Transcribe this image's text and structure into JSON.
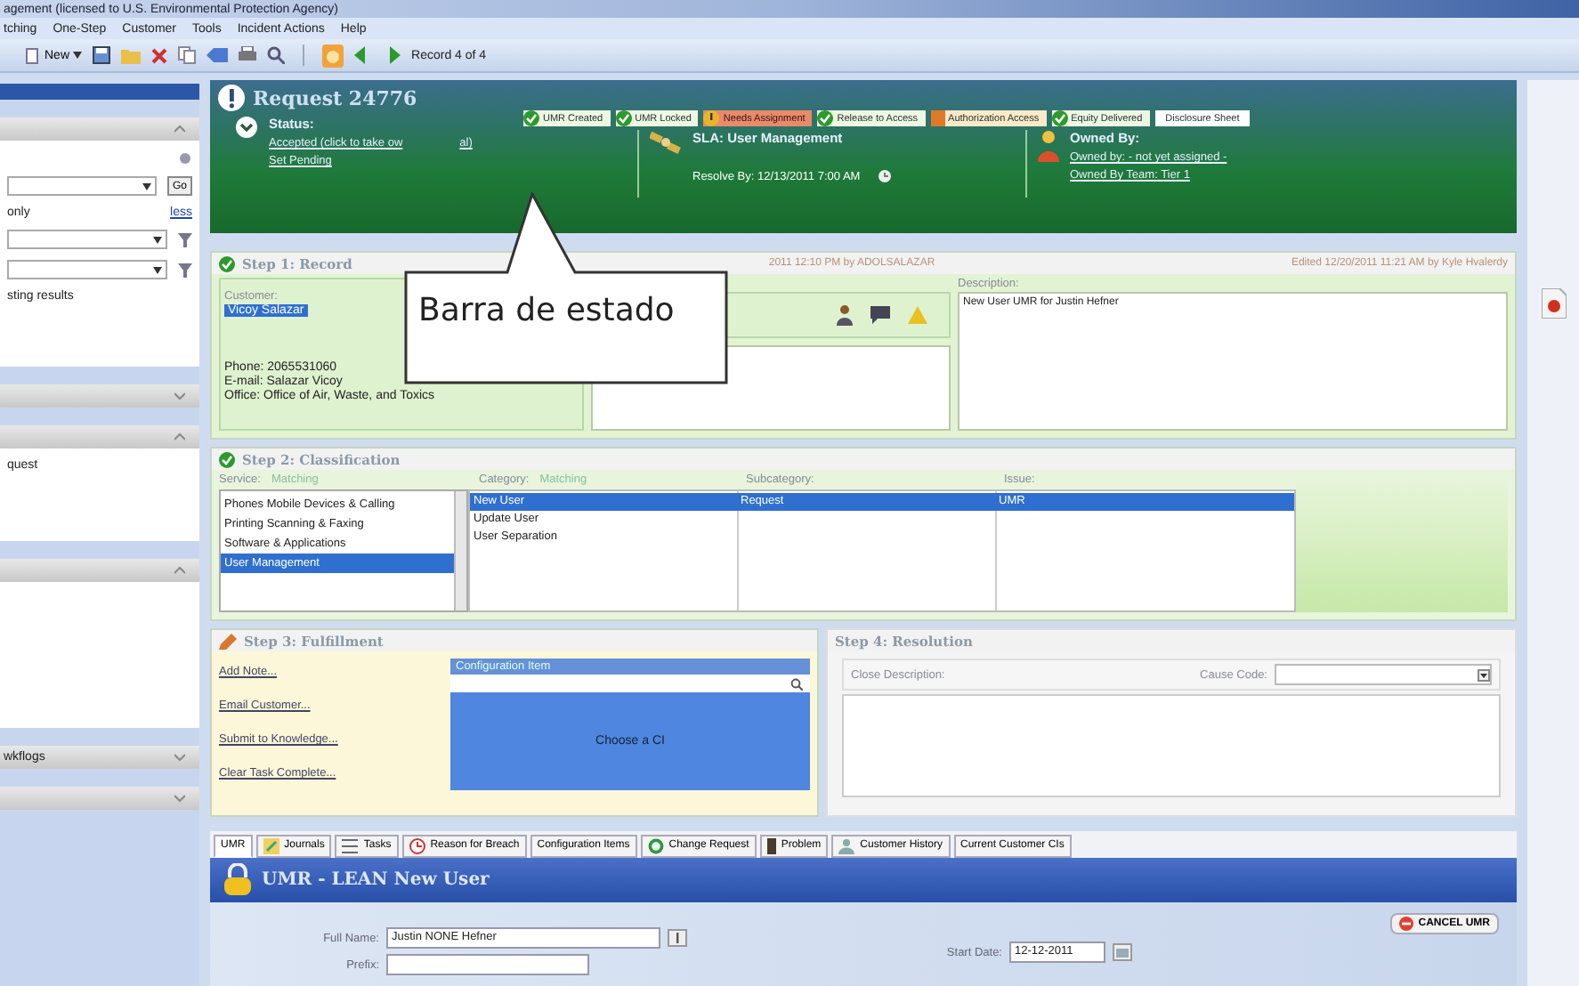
{
  "window": {
    "title": "agement (licensed to U.S. Environmental Protection Agency)"
  },
  "menu": [
    "tching",
    "One-Step",
    "Customer",
    "Tools",
    "Incident Actions",
    "Help"
  ],
  "toolbar": {
    "new_label": "New",
    "record": "Record 4 of 4"
  },
  "sidebar": {
    "sections": [
      {
        "expanded": true,
        "rows": [
          {
            "kind": "icon"
          },
          {
            "kind": "dropdown",
            "button": "Go"
          },
          {
            "kind": "text",
            "text": "only",
            "link": "less"
          },
          {
            "kind": "dropdown"
          },
          {
            "kind": "dropdown"
          },
          {
            "kind": "text",
            "text": "sting results"
          }
        ]
      },
      {
        "expanded": false
      },
      {
        "expanded": true,
        "rows": [
          {
            "kind": "text",
            "text": "quest"
          }
        ]
      },
      {
        "expanded": true
      },
      {
        "expanded": false,
        "title": "wkflogs"
      },
      {
        "expanded": false
      }
    ]
  },
  "request": {
    "title": "Request 24776",
    "chips": [
      {
        "label": "UMR Created",
        "kind": "done"
      },
      {
        "label": "UMR Locked",
        "kind": "done"
      },
      {
        "label": "Needs Assignment",
        "kind": "alert"
      },
      {
        "label": "Release to Access",
        "kind": "done"
      },
      {
        "label": "Authorization Access",
        "kind": "warn"
      },
      {
        "label": "Equity Delivered",
        "kind": "done"
      },
      {
        "label": "Disclosure Sheet",
        "kind": "none"
      }
    ],
    "status": {
      "label": "Status:",
      "link": "Accepted (click to take ow",
      "link_tail": "al)",
      "action": "Set Pending"
    },
    "sla": {
      "title": "SLA: User Management",
      "resolve": "Resolve By: 12/13/2011 7:00 AM"
    },
    "owner": {
      "title": "Owned By:",
      "owned_by": "Owned by: - not yet assigned -",
      "team": "Owned By Team: Tier 1"
    }
  },
  "callout": {
    "text": "Barra de estado"
  },
  "step1": {
    "title": "Step 1: Record",
    "meta": "2011 12:10 PM by ADOLSALAZAR",
    "edited": "Edited 12/20/2011 11:21 AM by Kyle Hvalerdy",
    "customer_label": "Customer:",
    "customer": "Vicoy Salazar",
    "lines": [
      "Phone: 2065531060",
      "E-mail: Salazar Vicoy",
      "Office: Office of Air, Waste, and Toxics"
    ],
    "description_label": "Description:",
    "description": "New User UMR for Justin Hefner"
  },
  "step2": {
    "title": "Step 2: Classification",
    "service_label": "Service:",
    "category_label": "Category:",
    "match": "Matching",
    "match2": "Matching",
    "subcategory_label": "Subcategory:",
    "issue_label": "Issue:",
    "services": [
      {
        "label": "Phones Mobile Devices & Calling",
        "selected": false
      },
      {
        "label": "Printing Scanning & Faxing",
        "selected": false
      },
      {
        "label": "Software & Applications",
        "selected": false
      },
      {
        "label": "User Management",
        "selected": true
      }
    ],
    "rows": [
      {
        "category": "New User",
        "subcategory": "Request",
        "issue": "UMR",
        "selected": true
      },
      {
        "category": "Update User",
        "selected": false
      },
      {
        "category": "User Separation",
        "selected": false
      }
    ]
  },
  "step3": {
    "title": "Step 3: Fulfillment",
    "links": [
      "Add Note...",
      "Email Customer...",
      "Submit to Knowledge...",
      "Clear Task Complete..."
    ],
    "ci_label": "Configuration Item",
    "choose": "Choose a CI"
  },
  "step4": {
    "title": "Step 4: Resolution",
    "close_label": "Close Description:",
    "cause_label": "Cause Code:"
  },
  "tabs": [
    {
      "label": "UMR",
      "selected": true
    },
    {
      "label": "Journals",
      "selected": false
    },
    {
      "label": "Tasks",
      "selected": false
    },
    {
      "label": "Reason for Breach",
      "selected": false
    },
    {
      "label": "Configuration Items",
      "selected": false
    },
    {
      "label": "Change Request",
      "selected": false
    },
    {
      "label": "Problem",
      "selected": false
    },
    {
      "label": "Customer History",
      "selected": false
    },
    {
      "label": "Current Customer CIs",
      "selected": false
    }
  ],
  "umr": {
    "title": "UMR - LEAN New User",
    "full_name_label": "Full Name:",
    "full_name": "Justin NONE Hefner",
    "prefix_label": "Prefix:",
    "start_label": "Start Date:",
    "start": "12-12-2011",
    "cancel": "CANCEL UMR"
  }
}
